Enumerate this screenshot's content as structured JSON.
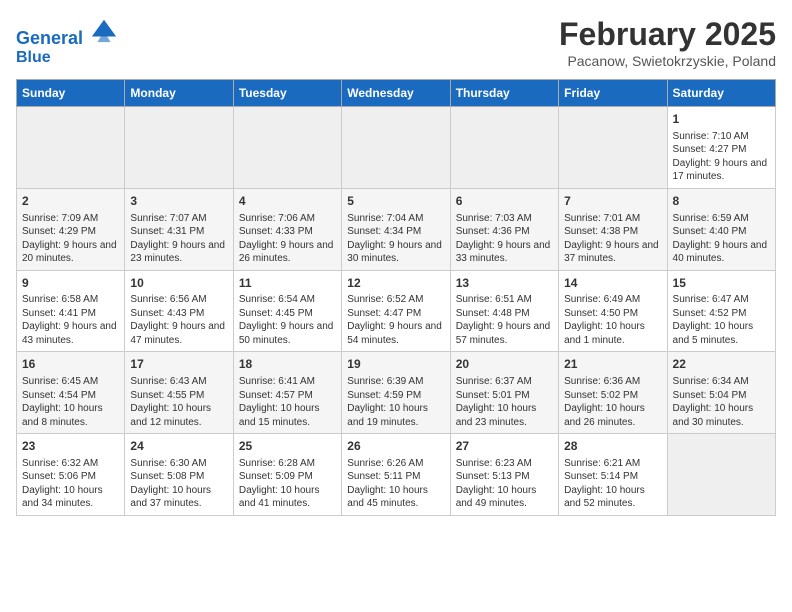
{
  "header": {
    "logo_line1": "General",
    "logo_line2": "Blue",
    "month_title": "February 2025",
    "location": "Pacanow, Swietokrzyskie, Poland"
  },
  "days_of_week": [
    "Sunday",
    "Monday",
    "Tuesday",
    "Wednesday",
    "Thursday",
    "Friday",
    "Saturday"
  ],
  "weeks": [
    [
      {
        "day": "",
        "info": ""
      },
      {
        "day": "",
        "info": ""
      },
      {
        "day": "",
        "info": ""
      },
      {
        "day": "",
        "info": ""
      },
      {
        "day": "",
        "info": ""
      },
      {
        "day": "",
        "info": ""
      },
      {
        "day": "1",
        "info": "Sunrise: 7:10 AM\nSunset: 4:27 PM\nDaylight: 9 hours and 17 minutes."
      }
    ],
    [
      {
        "day": "2",
        "info": "Sunrise: 7:09 AM\nSunset: 4:29 PM\nDaylight: 9 hours and 20 minutes."
      },
      {
        "day": "3",
        "info": "Sunrise: 7:07 AM\nSunset: 4:31 PM\nDaylight: 9 hours and 23 minutes."
      },
      {
        "day": "4",
        "info": "Sunrise: 7:06 AM\nSunset: 4:33 PM\nDaylight: 9 hours and 26 minutes."
      },
      {
        "day": "5",
        "info": "Sunrise: 7:04 AM\nSunset: 4:34 PM\nDaylight: 9 hours and 30 minutes."
      },
      {
        "day": "6",
        "info": "Sunrise: 7:03 AM\nSunset: 4:36 PM\nDaylight: 9 hours and 33 minutes."
      },
      {
        "day": "7",
        "info": "Sunrise: 7:01 AM\nSunset: 4:38 PM\nDaylight: 9 hours and 37 minutes."
      },
      {
        "day": "8",
        "info": "Sunrise: 6:59 AM\nSunset: 4:40 PM\nDaylight: 9 hours and 40 minutes."
      }
    ],
    [
      {
        "day": "9",
        "info": "Sunrise: 6:58 AM\nSunset: 4:41 PM\nDaylight: 9 hours and 43 minutes."
      },
      {
        "day": "10",
        "info": "Sunrise: 6:56 AM\nSunset: 4:43 PM\nDaylight: 9 hours and 47 minutes."
      },
      {
        "day": "11",
        "info": "Sunrise: 6:54 AM\nSunset: 4:45 PM\nDaylight: 9 hours and 50 minutes."
      },
      {
        "day": "12",
        "info": "Sunrise: 6:52 AM\nSunset: 4:47 PM\nDaylight: 9 hours and 54 minutes."
      },
      {
        "day": "13",
        "info": "Sunrise: 6:51 AM\nSunset: 4:48 PM\nDaylight: 9 hours and 57 minutes."
      },
      {
        "day": "14",
        "info": "Sunrise: 6:49 AM\nSunset: 4:50 PM\nDaylight: 10 hours and 1 minute."
      },
      {
        "day": "15",
        "info": "Sunrise: 6:47 AM\nSunset: 4:52 PM\nDaylight: 10 hours and 5 minutes."
      }
    ],
    [
      {
        "day": "16",
        "info": "Sunrise: 6:45 AM\nSunset: 4:54 PM\nDaylight: 10 hours and 8 minutes."
      },
      {
        "day": "17",
        "info": "Sunrise: 6:43 AM\nSunset: 4:55 PM\nDaylight: 10 hours and 12 minutes."
      },
      {
        "day": "18",
        "info": "Sunrise: 6:41 AM\nSunset: 4:57 PM\nDaylight: 10 hours and 15 minutes."
      },
      {
        "day": "19",
        "info": "Sunrise: 6:39 AM\nSunset: 4:59 PM\nDaylight: 10 hours and 19 minutes."
      },
      {
        "day": "20",
        "info": "Sunrise: 6:37 AM\nSunset: 5:01 PM\nDaylight: 10 hours and 23 minutes."
      },
      {
        "day": "21",
        "info": "Sunrise: 6:36 AM\nSunset: 5:02 PM\nDaylight: 10 hours and 26 minutes."
      },
      {
        "day": "22",
        "info": "Sunrise: 6:34 AM\nSunset: 5:04 PM\nDaylight: 10 hours and 30 minutes."
      }
    ],
    [
      {
        "day": "23",
        "info": "Sunrise: 6:32 AM\nSunset: 5:06 PM\nDaylight: 10 hours and 34 minutes."
      },
      {
        "day": "24",
        "info": "Sunrise: 6:30 AM\nSunset: 5:08 PM\nDaylight: 10 hours and 37 minutes."
      },
      {
        "day": "25",
        "info": "Sunrise: 6:28 AM\nSunset: 5:09 PM\nDaylight: 10 hours and 41 minutes."
      },
      {
        "day": "26",
        "info": "Sunrise: 6:26 AM\nSunset: 5:11 PM\nDaylight: 10 hours and 45 minutes."
      },
      {
        "day": "27",
        "info": "Sunrise: 6:23 AM\nSunset: 5:13 PM\nDaylight: 10 hours and 49 minutes."
      },
      {
        "day": "28",
        "info": "Sunrise: 6:21 AM\nSunset: 5:14 PM\nDaylight: 10 hours and 52 minutes."
      },
      {
        "day": "",
        "info": ""
      }
    ]
  ]
}
